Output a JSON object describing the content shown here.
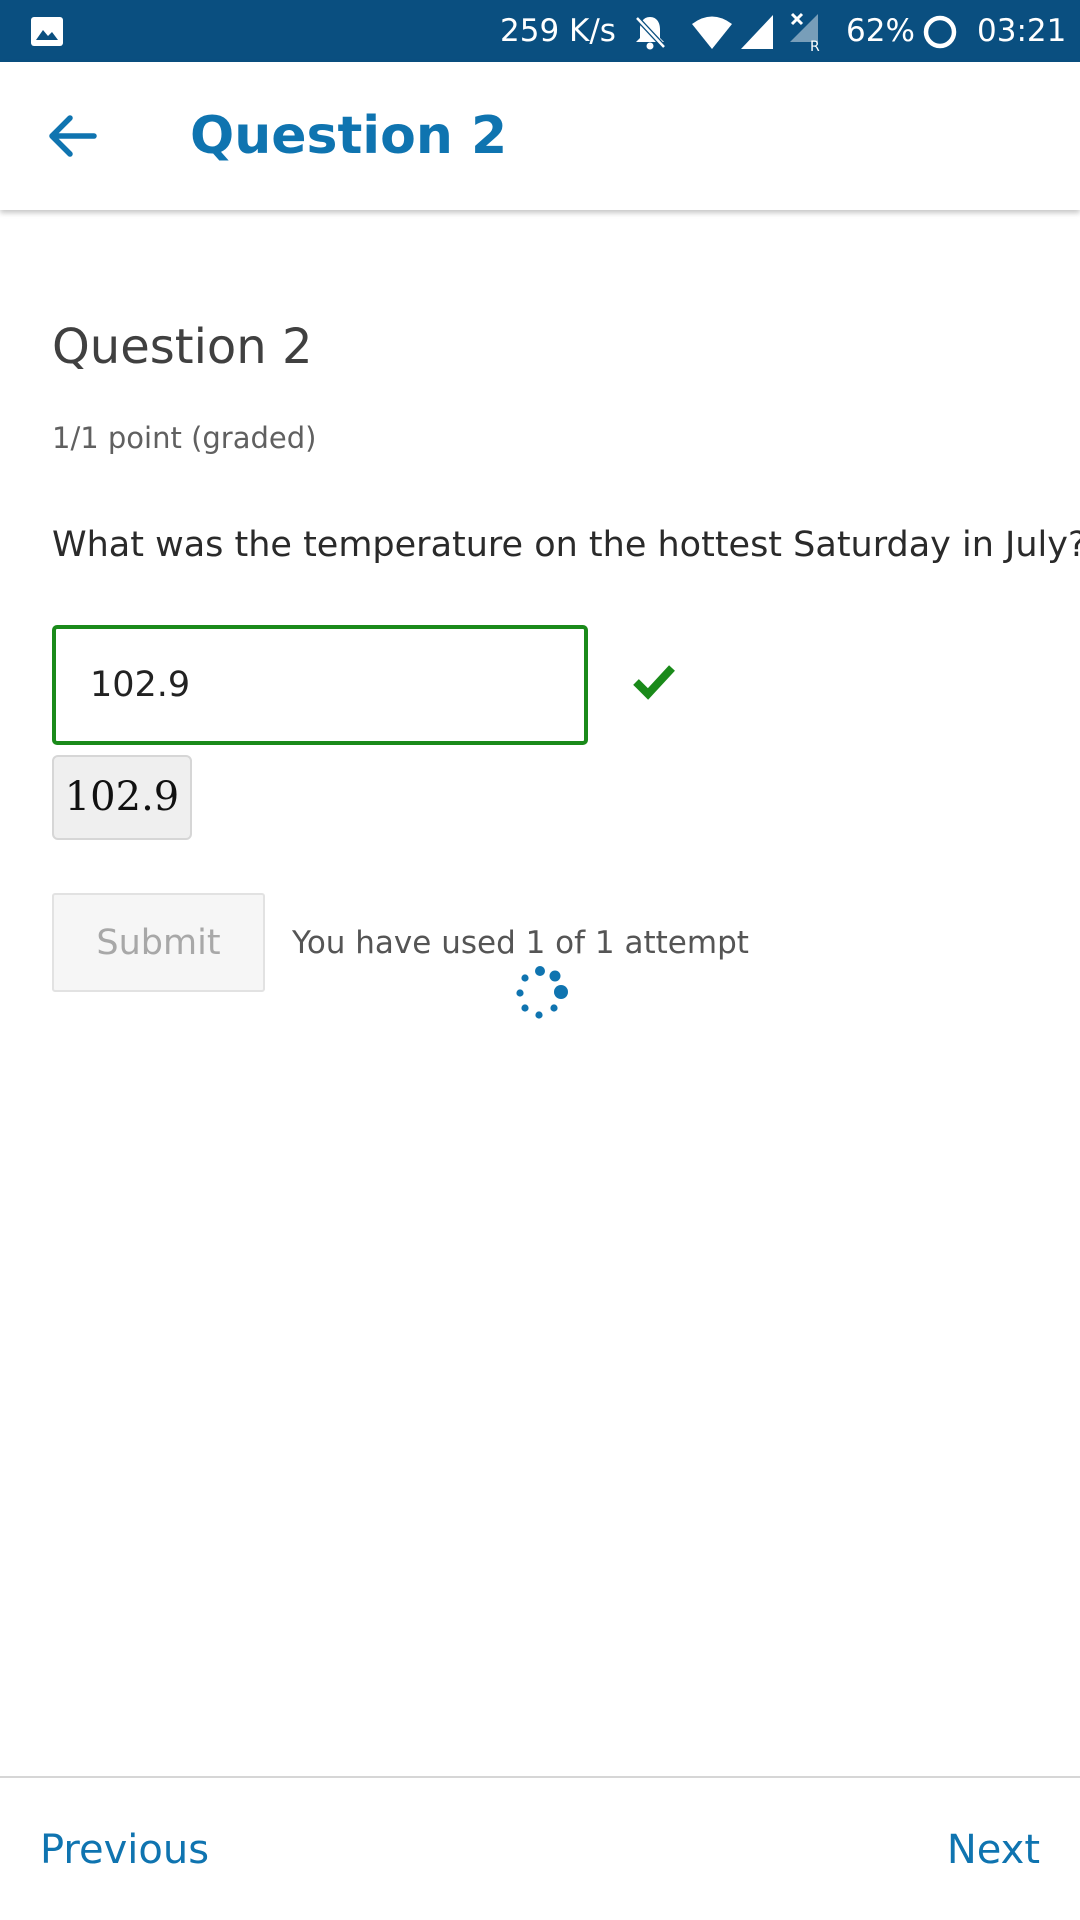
{
  "status_bar": {
    "network_speed": "259 K/s",
    "battery": "62%",
    "time": "03:21",
    "icons": [
      "gallery-icon",
      "bell-off-icon",
      "wifi-icon",
      "signal-icon",
      "signal-roaming-icon",
      "battery-ring-icon"
    ]
  },
  "app_bar": {
    "title": "Question 2",
    "back_icon": "arrow-left-icon"
  },
  "question": {
    "heading": "Question 2",
    "points": "1/1 point (graded)",
    "prompt": "What was the temperature on the hottest Saturday in July?",
    "answer_value": "102.9",
    "answer_preview": "102.9",
    "status_icon": "check-icon"
  },
  "actions": {
    "submit_label": "Submit",
    "attempts_text": "You have used 1 of 1 attempt"
  },
  "bottom_nav": {
    "previous_label": "Previous",
    "next_label": "Next"
  },
  "colors": {
    "status_bar": "#0a4f80",
    "accent": "#0f74b0",
    "correct": "#1a8a1a"
  }
}
